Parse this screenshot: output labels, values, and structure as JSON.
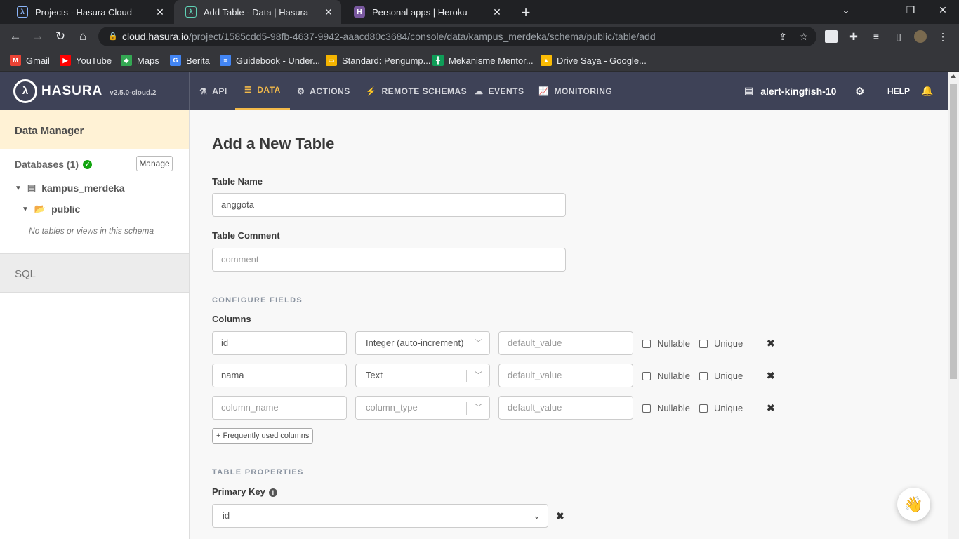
{
  "browser": {
    "tabs": [
      {
        "title": "Projects - Hasura Cloud",
        "icon": "hasura-icon",
        "active": false
      },
      {
        "title": "Add Table - Data | Hasura",
        "icon": "hasura-icon",
        "active": true
      },
      {
        "title": "Personal apps | Heroku",
        "icon": "heroku-icon",
        "active": false
      }
    ],
    "url_host": "cloud.hasura.io",
    "url_path": "/project/1585cdd5-98fb-4637-9942-aaacd80c3684/console/data/kampus_merdeka/schema/public/table/add",
    "bookmarks": [
      {
        "label": "Gmail",
        "icon": "gmail-icon",
        "color": "#ea4335"
      },
      {
        "label": "YouTube",
        "icon": "youtube-icon",
        "color": "#ff0000"
      },
      {
        "label": "Maps",
        "icon": "maps-icon",
        "color": "#34a853"
      },
      {
        "label": "Berita",
        "icon": "news-icon",
        "color": "#4285f4"
      },
      {
        "label": "Guidebook - Under...",
        "icon": "docs-icon",
        "color": "#4285f4"
      },
      {
        "label": "Standard: Pengump...",
        "icon": "slides-icon",
        "color": "#f4b400"
      },
      {
        "label": "Mekanisme Mentor...",
        "icon": "sheets-icon",
        "color": "#0f9d58"
      },
      {
        "label": "Drive Saya - Google...",
        "icon": "drive-icon",
        "color": "#fbbc04"
      }
    ]
  },
  "hasura": {
    "logo_text": "HASURA",
    "version": "v2.5.0-cloud.2",
    "nav": [
      {
        "label": "API",
        "icon": "flask-icon"
      },
      {
        "label": "DATA",
        "icon": "database-icon",
        "active": true
      },
      {
        "label": "ACTIONS",
        "icon": "gears-icon"
      },
      {
        "label": "REMOTE SCHEMAS",
        "icon": "plug-icon"
      },
      {
        "label": "EVENTS",
        "icon": "cloud-icon"
      },
      {
        "label": "MONITORING",
        "icon": "chart-icon"
      }
    ],
    "project_name": "alert-kingfish-10",
    "help_label": "HELP"
  },
  "sidebar": {
    "header": "Data Manager",
    "databases_label": "Databases (1)",
    "manage_label": "Manage",
    "database_name": "kampus_merdeka",
    "schema_name": "public",
    "empty_note": "No tables or views in this schema",
    "sql_label": "SQL"
  },
  "form": {
    "page_title": "Add a New Table",
    "table_name_label": "Table Name",
    "table_name_value": "anggota",
    "table_comment_label": "Table Comment",
    "table_comment_placeholder": "comment",
    "configure_fields_title": "CONFIGURE FIELDS",
    "columns_label": "Columns",
    "columns": [
      {
        "name": "id",
        "name_placeholder": "column_name",
        "type": "Integer (auto-increment)",
        "type_is_placeholder": false,
        "default_placeholder": "default_value"
      },
      {
        "name": "nama",
        "name_placeholder": "column_name",
        "type": "Text",
        "type_is_placeholder": false,
        "default_placeholder": "default_value"
      },
      {
        "name": "",
        "name_placeholder": "column_name",
        "type": "column_type",
        "type_is_placeholder": true,
        "default_placeholder": "default_value"
      }
    ],
    "nullable_label": "Nullable",
    "unique_label": "Unique",
    "frequently_used_label": "+ Frequently used columns",
    "table_properties_title": "TABLE PROPERTIES",
    "primary_key_label": "Primary Key",
    "primary_key_value": "id"
  }
}
